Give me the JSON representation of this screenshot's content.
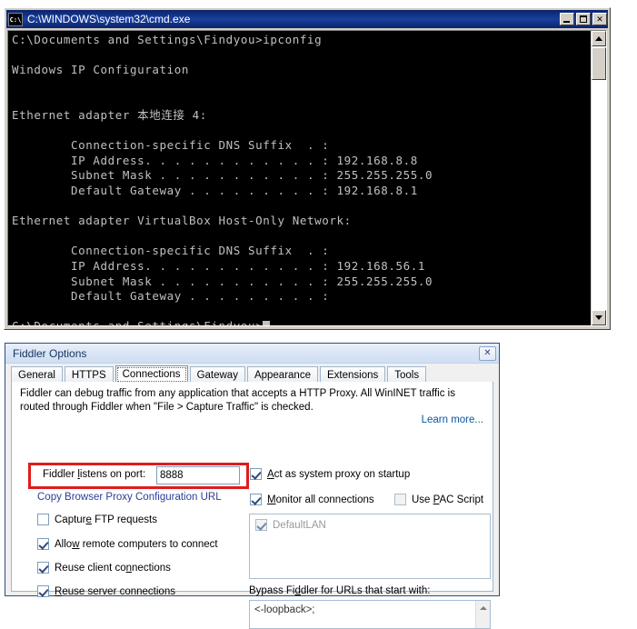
{
  "cmd_window": {
    "title": "C:\\WINDOWS\\system32\\cmd.exe",
    "icon_name": "cmd-icon",
    "minimize_label": "",
    "maximize_label": "",
    "close_label": "✕",
    "console_text": "C:\\Documents and Settings\\Findyou>ipconfig\n\nWindows IP Configuration\n\n\nEthernet adapter 本地连接 4:\n\n        Connection-specific DNS Suffix  . :\n        IP Address. . . . . . . . . . . . : 192.168.8.8\n        Subnet Mask . . . . . . . . . . . : 255.255.255.0\n        Default Gateway . . . . . . . . . : 192.168.8.1\n\nEthernet adapter VirtualBox Host-Only Network:\n\n        Connection-specific DNS Suffix  . :\n        IP Address. . . . . . . . . . . . : 192.168.56.1\n        Subnet Mask . . . . . . . . . . . : 255.255.255.0\n        Default Gateway . . . . . . . . . :\n\nC:\\Documents and Settings\\Findyou>",
    "prompt": "C:\\Documents and Settings\\Findyou>",
    "command": "ipconfig",
    "adapters": [
      {
        "name": "Ethernet adapter 本地连接 4:",
        "dns_suffix": "",
        "ip_address": "192.168.8.8",
        "subnet_mask": "255.255.255.0",
        "default_gateway": "192.168.8.1"
      },
      {
        "name": "Ethernet adapter VirtualBox Host-Only Network:",
        "dns_suffix": "",
        "ip_address": "192.168.56.1",
        "subnet_mask": "255.255.255.0",
        "default_gateway": ""
      }
    ]
  },
  "fiddler": {
    "title": "Fiddler Options",
    "close_label": "✕",
    "tabs": [
      {
        "label": "General",
        "selected": false
      },
      {
        "label": "HTTPS",
        "selected": false
      },
      {
        "label": "Connections",
        "selected": true
      },
      {
        "label": "Gateway",
        "selected": false
      },
      {
        "label": "Appearance",
        "selected": false
      },
      {
        "label": "Extensions",
        "selected": false
      },
      {
        "label": "Tools",
        "selected": false
      }
    ],
    "description": "Fiddler can debug traffic from any application that accepts a HTTP Proxy. All WinINET traffic is routed through Fiddler when \"File > Capture Traffic\" is checked.",
    "learn_more": "Learn more...",
    "port_label_pre": "Fiddler ",
    "port_label_underline": "l",
    "port_label_post": "istens on port:",
    "port_value": "8888",
    "copy_url_link": "Copy Browser Proxy Configuration URL",
    "left_checkboxes": [
      {
        "label_pre": "Captur",
        "label_underline": "e",
        "label_post": " FTP requests",
        "checked": false
      },
      {
        "label_pre": "Allo",
        "label_underline": "w",
        "label_post": " remote computers to connect",
        "checked": true
      },
      {
        "label_pre": "Reuse client co",
        "label_underline": "n",
        "label_post": "nections",
        "checked": true
      },
      {
        "label_pre": "",
        "label_underline": "R",
        "label_post": "euse server connections",
        "checked": true
      }
    ],
    "right_checkboxes": [
      {
        "label_pre": "",
        "label_underline": "A",
        "label_post": "ct as system proxy on startup",
        "checked": true
      },
      {
        "label_pre": "",
        "label_underline": "M",
        "label_post": "onitor all connections",
        "checked": true
      },
      {
        "label_pre": "Use ",
        "label_underline": "P",
        "label_post": "AC Script",
        "checked": false
      }
    ],
    "adapter_list": [
      {
        "label": "DefaultLAN",
        "checked": true,
        "disabled": true
      }
    ],
    "bypass_label_pre": "Bypass Fi",
    "bypass_label_underline": "d",
    "bypass_label_post": "dler for URLs that start with:",
    "bypass_value": "<-loopback>;",
    "accent_highlight_color": "#e01b1b",
    "link_color": "#2b3f96"
  }
}
